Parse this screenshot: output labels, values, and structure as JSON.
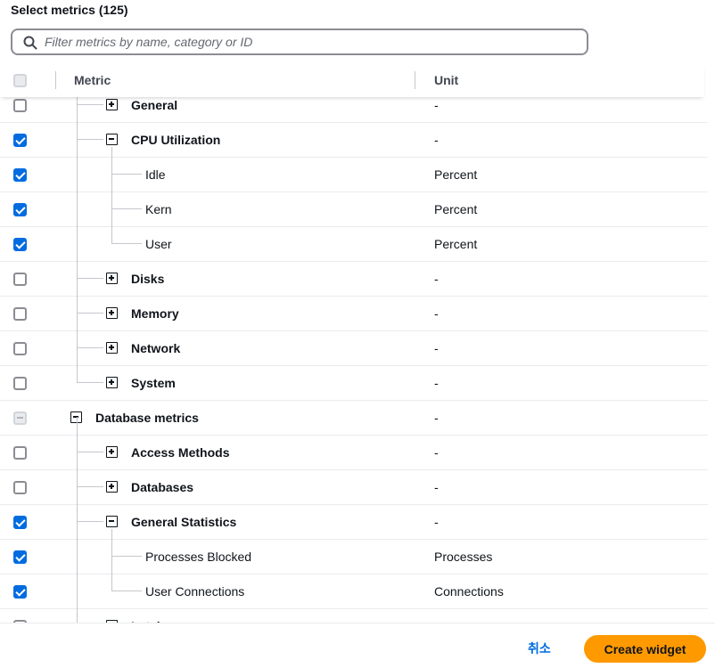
{
  "header": {
    "title": "Select metrics (125)"
  },
  "search": {
    "placeholder": "Filter metrics by name, category or ID",
    "value": ""
  },
  "columns": {
    "metric": "Metric",
    "unit": "Unit"
  },
  "rows": [
    {
      "label": "General",
      "unit": "-",
      "state": "unchecked",
      "level": 2,
      "toggle": "plus",
      "bold": true
    },
    {
      "label": "CPU Utilization",
      "unit": "-",
      "state": "checked",
      "level": 2,
      "toggle": "minus",
      "bold": true
    },
    {
      "label": "Idle",
      "unit": "Percent",
      "state": "checked",
      "level": 3,
      "toggle": "none",
      "bold": false
    },
    {
      "label": "Kern",
      "unit": "Percent",
      "state": "checked",
      "level": 3,
      "toggle": "none",
      "bold": false
    },
    {
      "label": "User",
      "unit": "Percent",
      "state": "checked",
      "level": 3,
      "toggle": "none",
      "bold": false
    },
    {
      "label": "Disks",
      "unit": "-",
      "state": "unchecked",
      "level": 2,
      "toggle": "plus",
      "bold": true
    },
    {
      "label": "Memory",
      "unit": "-",
      "state": "unchecked",
      "level": 2,
      "toggle": "plus",
      "bold": true
    },
    {
      "label": "Network",
      "unit": "-",
      "state": "unchecked",
      "level": 2,
      "toggle": "plus",
      "bold": true
    },
    {
      "label": "System",
      "unit": "-",
      "state": "unchecked",
      "level": 2,
      "toggle": "plus",
      "bold": true
    },
    {
      "label": "Database metrics",
      "unit": "-",
      "state": "indeterminate",
      "level": 1,
      "toggle": "minus",
      "bold": true
    },
    {
      "label": "Access Methods",
      "unit": "-",
      "state": "unchecked",
      "level": 2,
      "toggle": "plus",
      "bold": true
    },
    {
      "label": "Databases",
      "unit": "-",
      "state": "unchecked",
      "level": 2,
      "toggle": "plus",
      "bold": true
    },
    {
      "label": "General Statistics",
      "unit": "-",
      "state": "checked",
      "level": 2,
      "toggle": "minus",
      "bold": true
    },
    {
      "label": "Processes Blocked",
      "unit": "Processes",
      "state": "checked",
      "level": 3,
      "toggle": "none",
      "bold": false
    },
    {
      "label": "User Connections",
      "unit": "Connections",
      "state": "checked",
      "level": 3,
      "toggle": "none",
      "bold": false
    },
    {
      "label": "Latches",
      "unit": "-",
      "state": "unchecked",
      "level": 2,
      "toggle": "plus",
      "bold": true
    }
  ],
  "footer": {
    "cancel_label": "취소",
    "create_label": "Create widget"
  },
  "icons": {
    "search": "search-icon",
    "expand": "plus-square-icon",
    "collapse": "minus-square-icon"
  },
  "colors": {
    "accent": "#006ce0",
    "primary_button": "#ff9900"
  }
}
